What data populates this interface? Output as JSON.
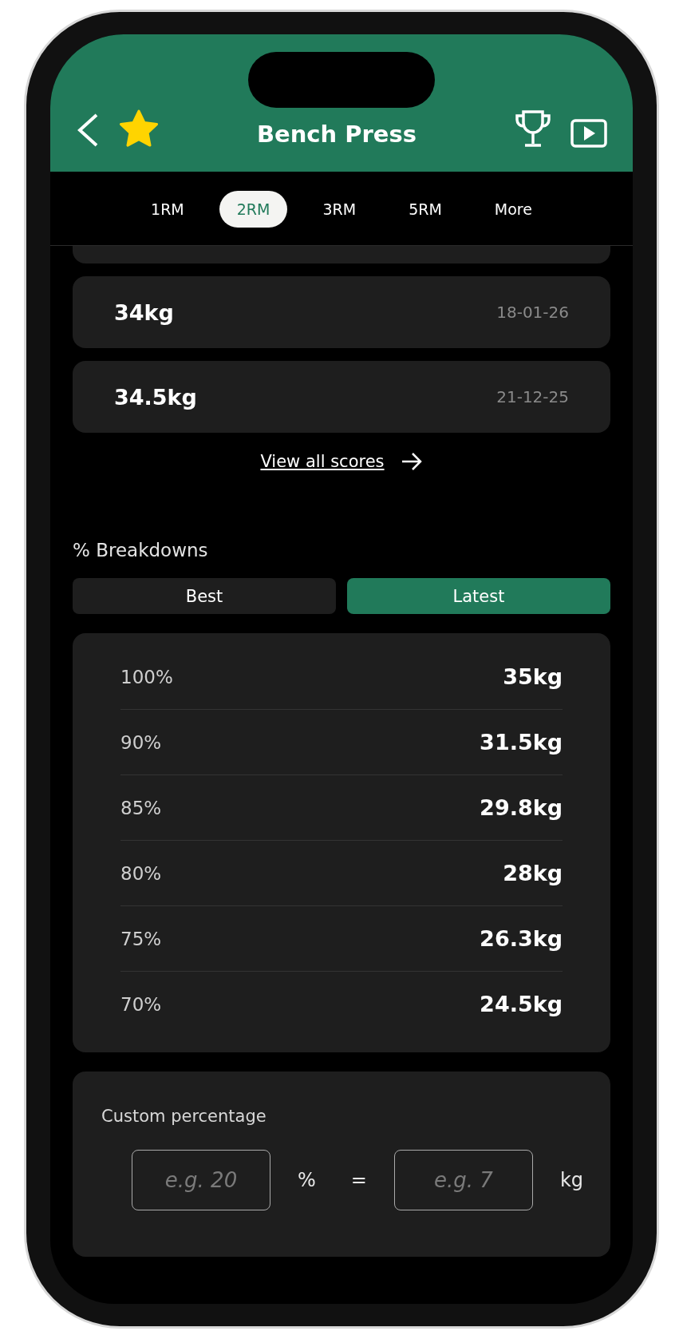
{
  "header": {
    "title": "Bench Press",
    "favorite": true
  },
  "rep_tabs": [
    {
      "label": "1RM",
      "selected": false
    },
    {
      "label": "2RM",
      "selected": true
    },
    {
      "label": "3RM",
      "selected": false
    },
    {
      "label": "5RM",
      "selected": false
    },
    {
      "label": "More",
      "selected": false
    }
  ],
  "scores": [
    {
      "weight": "34kg",
      "date": "18-01-26"
    },
    {
      "weight": "34.5kg",
      "date": "21-12-25"
    }
  ],
  "view_all_link": "View all scores",
  "breakdowns": {
    "title": "% Breakdowns",
    "toggles": [
      {
        "label": "Best",
        "selected": false
      },
      {
        "label": "Latest",
        "selected": true
      }
    ],
    "rows": [
      {
        "percent": "100%",
        "weight": "35kg"
      },
      {
        "percent": "90%",
        "weight": "31.5kg"
      },
      {
        "percent": "85%",
        "weight": "29.8kg"
      },
      {
        "percent": "80%",
        "weight": "28kg"
      },
      {
        "percent": "75%",
        "weight": "26.3kg"
      },
      {
        "percent": "70%",
        "weight": "24.5kg"
      }
    ]
  },
  "custom": {
    "label": "Custom percentage",
    "percent_field": {
      "placeholder": "e.g. 20"
    },
    "percent_sign": "%",
    "equals": "=",
    "weight_field": {
      "placeholder": "e.g. 7"
    },
    "unit": "kg"
  }
}
